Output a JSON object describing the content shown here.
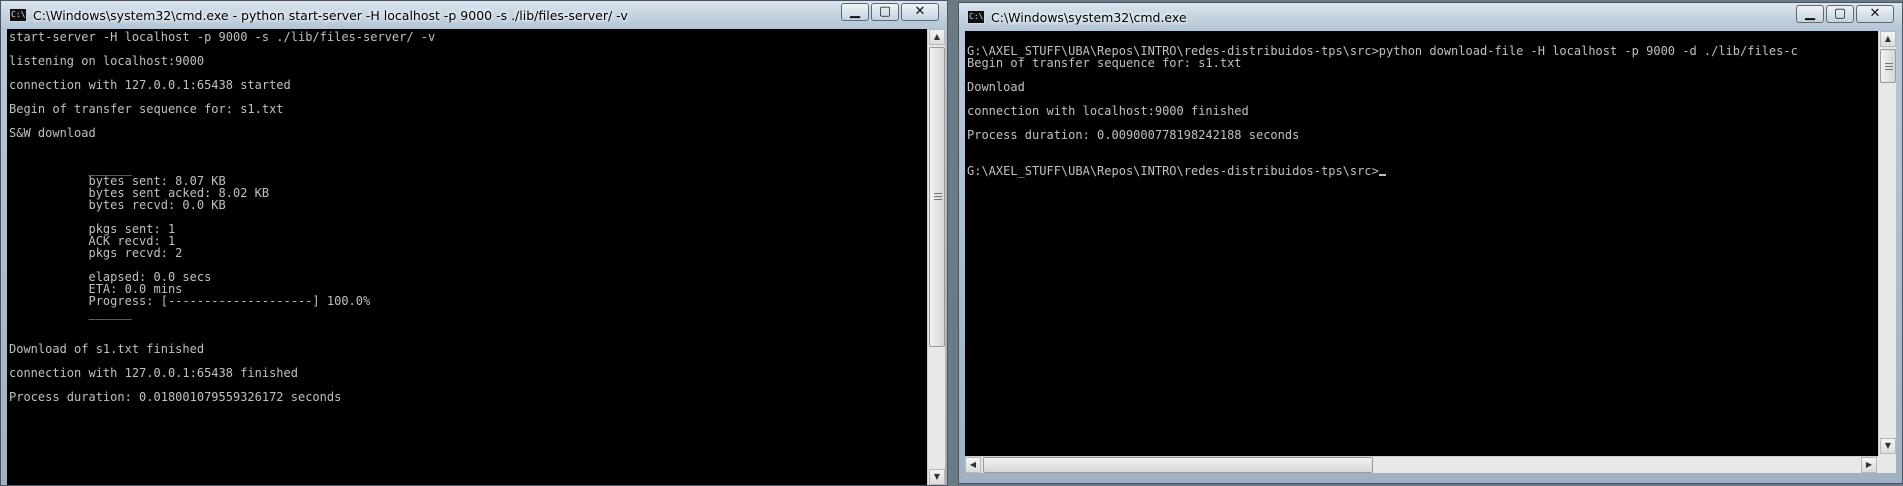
{
  "left_window": {
    "title": "C:\\Windows\\system32\\cmd.exe - python  start-server -H localhost -p 9000 -s ./lib/files-server/ -v",
    "controls": {
      "minimize": "▁",
      "maximize": "▢",
      "close": "✕"
    },
    "lines": [
      "start-server -H localhost -p 9000 -s ./lib/files-server/ -v",
      "",
      "listening on localhost:9000",
      "",
      "connection with 127.0.0.1:65438 started",
      "",
      "Begin of transfer sequence for: s1.txt",
      "",
      "S&W download",
      "",
      "",
      "           ______",
      "           bytes sent: 8.07 KB",
      "           bytes sent acked: 8.02 KB",
      "           bytes recvd: 0.0 KB",
      "",
      "           pkgs sent: 1",
      "           ACK recvd: 1",
      "           pkgs recvd: 2",
      "",
      "           elapsed: 0.0 secs",
      "           ETA: 0.0 mins",
      "           Progress: [--------------------] 100.0%",
      "           ______",
      "",
      "",
      "Download of s1.txt finished",
      "",
      "connection with 127.0.0.1:65438 finished",
      "",
      "Process duration: 0.018001079559326172 seconds"
    ]
  },
  "right_window": {
    "title": "C:\\Windows\\system32\\cmd.exe",
    "controls": {
      "minimize": "▁",
      "maximize": "▢",
      "close": "✕"
    },
    "lines": [
      "",
      "G:\\AXEL_STUFF\\UBA\\Repos\\INTRO\\redes-distribuidos-tps\\src>python download-file -H localhost -p 9000 -d ./lib/files-c",
      "Begin of transfer sequence for: s1.txt",
      "",
      "Download",
      "",
      "connection with localhost:9000 finished",
      "",
      "Process duration: 0.009000778198242188 seconds",
      "",
      "",
      "G:\\AXEL_STUFF\\UBA\\Repos\\INTRO\\redes-distribuidos-tps\\src>"
    ]
  },
  "scrollbar": {
    "up_arrow": "▲",
    "down_arrow": "▼",
    "left_arrow": "◀",
    "right_arrow": "▶"
  },
  "colors": {
    "console_bg": "#000000",
    "console_text": "#c0c0c0",
    "chrome": "#b9c9d8"
  }
}
